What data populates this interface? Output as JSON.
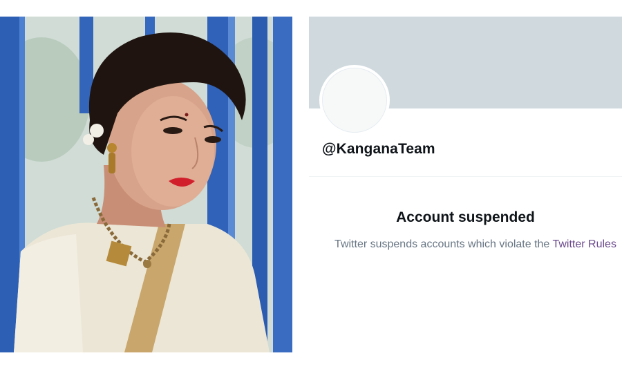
{
  "profile": {
    "handle": "@KanganaTeam",
    "suspension_title": "Account suspended",
    "suspension_message": "Twitter suspends accounts which violate the",
    "rules_link": "Twitter Rules"
  },
  "colors": {
    "banner": "#cfd9de",
    "link": "#6b4a8c",
    "body_text": "#687684",
    "heading_text": "#0f1419"
  }
}
